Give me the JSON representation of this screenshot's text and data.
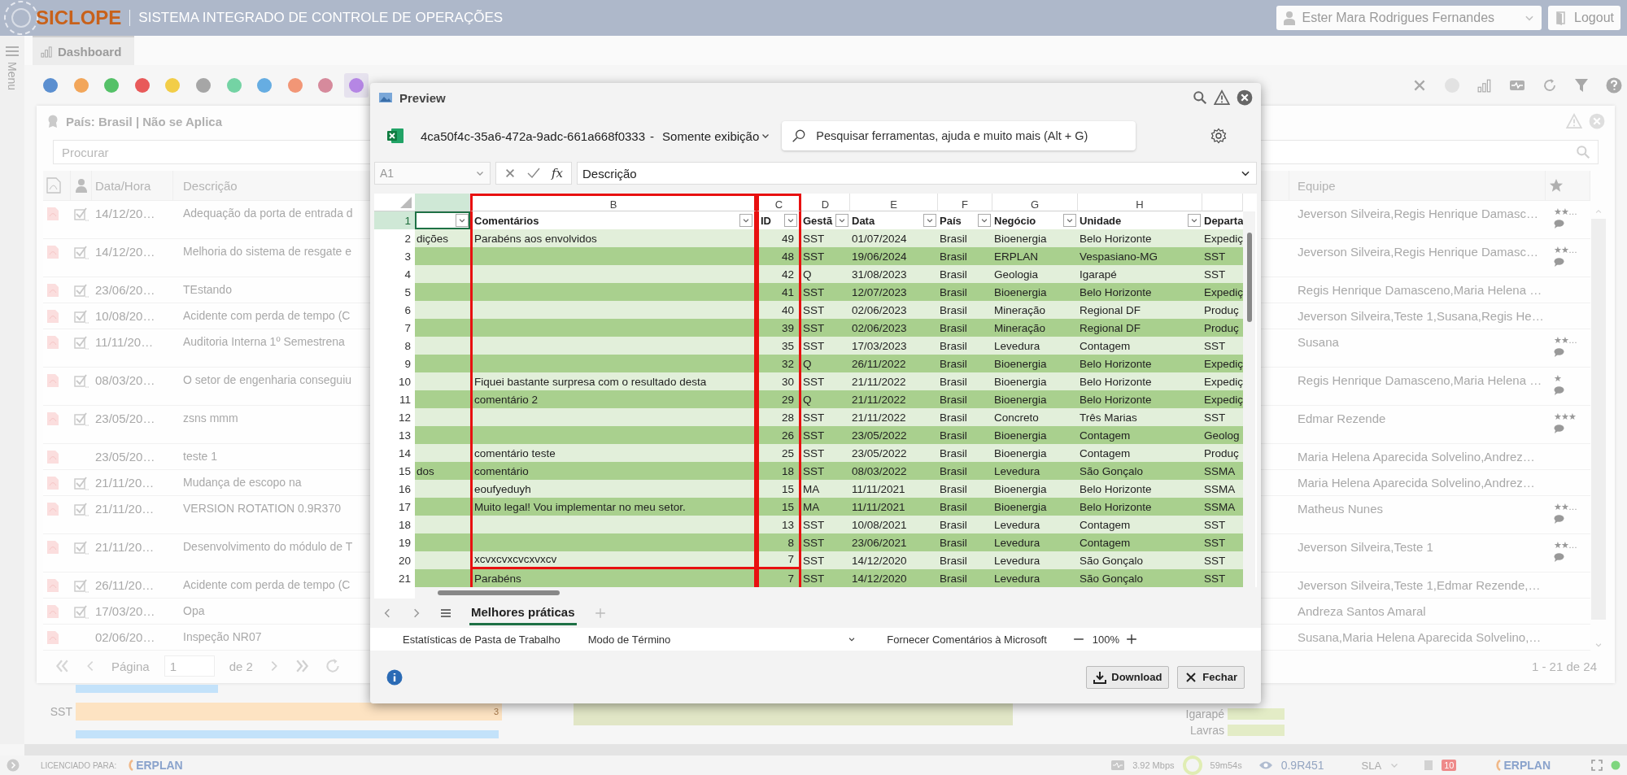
{
  "header": {
    "logo": "SICLOPE",
    "title": "SISTEMA INTEGRADO DE CONTROLE DE OPERAÇÕES",
    "user": "Ester Mara Rodrigues Fernandes",
    "logout": "Logout"
  },
  "sidebar": {
    "label": "Menu"
  },
  "tabs": [
    {
      "label": "Dashboard",
      "selected": true
    }
  ],
  "color_filters": [
    {
      "color": "#5b8fd0",
      "selected": false
    },
    {
      "color": "#f2a65a",
      "selected": false
    },
    {
      "color": "#55c168",
      "selected": false
    },
    {
      "color": "#e85a5a",
      "selected": false
    },
    {
      "color": "#f2cd48",
      "selected": false
    },
    {
      "color": "#a6a6a6",
      "selected": false
    },
    {
      "color": "#74d3a4",
      "selected": false
    },
    {
      "color": "#66ade2",
      "selected": false
    },
    {
      "color": "#f29676",
      "selected": false
    },
    {
      "color": "#d68a9c",
      "selected": false
    },
    {
      "color": "#b586e4",
      "selected": true
    }
  ],
  "panel": {
    "title": "País: Brasil | Não se Aplica",
    "search": {
      "placeholder": "Procurar"
    },
    "columns": {
      "date": "Data/Hora",
      "description": "Descrição",
      "team": "Equipe"
    },
    "rows": [
      {
        "checked": true,
        "date": "14/12/20…",
        "description": "Adequação da porta de entrada d",
        "team": "Jeverson Silveira,Regis Henrique Damasc…",
        "rating": "★★…",
        "comment": true
      },
      {
        "checked": true,
        "date": "14/12/20…",
        "description": "Melhoria do sistema de resgate e",
        "team": "Jeverson Silveira,Regis Henrique Damasc…",
        "rating": "★★…",
        "comment": true
      },
      {
        "checked": true,
        "date": "23/06/20…",
        "description": "TEstando",
        "team": "Regis Henrique Damasceno,Maria Helena …",
        "comment": false
      },
      {
        "checked": true,
        "date": "10/08/20…",
        "description": "Acidente com perda de tempo (C",
        "team": "Jeverson Silveira,Teste 1,Susana,Regis He…",
        "comment": false
      },
      {
        "checked": true,
        "date": "11/11/20…",
        "description": "Auditoria Interna 1º Semestrena",
        "team": "Susana",
        "rating": "★★…",
        "comment": true
      },
      {
        "checked": true,
        "date": "08/03/20…",
        "description": "O setor de engenharia conseguiu",
        "team": "Regis Henrique Damasceno,Maria Helena …",
        "rating": "★",
        "comment": true
      },
      {
        "checked": true,
        "date": "23/05/20…",
        "description": "zsns mmm",
        "team": "Edmar Rezende",
        "rating": "★★★",
        "comment": true
      },
      {
        "checked": false,
        "date": "23/05/20…",
        "description": "teste 1",
        "team": "Maria Helena Aparecida Solvelino,Andrez…",
        "comment": false
      },
      {
        "checked": true,
        "date": "21/11/20…",
        "description": "Mudança de escopo na",
        "team": "Maria Helena Aparecida Solvelino,Andrez…",
        "comment": false
      },
      {
        "checked": true,
        "date": "21/11/20…",
        "description": "VERSION ROTATION 0.9R370",
        "team": "Matheus Nunes",
        "rating": "★★…",
        "comment": true
      },
      {
        "checked": true,
        "date": "21/11/20…",
        "description": "Desenvolvimento do módulo de T",
        "team": "Jeverson Silveira,Teste 1",
        "rating": "★★…",
        "comment": true
      },
      {
        "checked": true,
        "date": "26/11/20…",
        "description": "Acidente com perda de tempo (C",
        "team": "Jeverson Silveira,Teste 1,Edmar Rezende,…",
        "comment": false
      },
      {
        "checked": true,
        "date": "17/03/20…",
        "description": "Opa",
        "team": "Andreza Santos Amaral",
        "comment": false
      },
      {
        "checked": false,
        "date": "02/06/20…",
        "description": "Inspeção NR07",
        "team": "Susana,Maria Helena Aparecida Solvelino,…",
        "comment": false
      }
    ],
    "pager": {
      "page_label": "Página",
      "page": "1",
      "of": "de 2",
      "range": "1 - 21 de 24"
    }
  },
  "background_chart": {
    "category": "SST",
    "bar_value": "3",
    "labels": [
      "Igarapé",
      "Lavras"
    ]
  },
  "preview": {
    "title": "Preview",
    "file_name": "4ca50f4c-35a6-472a-9adc-661a668f0333",
    "separator": "-",
    "mode": "Somente exibição",
    "search": {
      "placeholder": "Pesquisar ferramentas, ajuda e muito mais (Alt + G)"
    },
    "name_box": "A1",
    "function_label": "fx",
    "formula": "Descrição",
    "sheet": {
      "columns": [
        {
          "selected": true,
          "highlighted": false,
          "filter": true
        },
        {
          "letter": "B",
          "header": "Comentários",
          "selected": false,
          "highlighted": true,
          "filter": true
        },
        {
          "letter": "C",
          "header": "ID",
          "selected": false,
          "highlighted": true,
          "filter": true
        },
        {
          "letter": "D",
          "header": "Gestã",
          "selected": false,
          "highlighted": false,
          "filter": true
        },
        {
          "letter": "E",
          "header": "Data",
          "selected": false,
          "highlighted": false,
          "filter": true
        },
        {
          "letter": "F",
          "header": "País",
          "selected": false,
          "highlighted": false,
          "filter": true
        },
        {
          "letter": "G",
          "header": "Negócio",
          "selected": false,
          "highlighted": false,
          "filter": true
        },
        {
          "letter": "H",
          "header": "Unidade",
          "selected": false,
          "highlighted": false,
          "filter": true
        },
        {
          "header": "Departa",
          "selected": false,
          "highlighted": false,
          "filter": false
        }
      ],
      "header_row": {
        "number": "1",
        "selected": true
      },
      "rows": [
        {
          "number": "2",
          "a": "dições",
          "comments": "Parabéns aos envolvidos",
          "id": "49",
          "management": "SST",
          "date": "01/07/2024",
          "country": "Brasil",
          "business": "Bioenergia",
          "unit": "Belo Horizonte",
          "department": "Expediç"
        },
        {
          "number": "3",
          "id": "48",
          "management": "SST",
          "date": "19/06/2024",
          "country": "Brasil",
          "business": "ERPLAN",
          "unit": "Vespasiano-MG",
          "department": "SST"
        },
        {
          "number": "4",
          "id": "42",
          "management": "Q",
          "date": "31/08/2023",
          "country": "Brasil",
          "business": "Geologia",
          "unit": "Igarapé",
          "department": "SST"
        },
        {
          "number": "5",
          "id": "41",
          "management": "SST",
          "date": "12/07/2023",
          "country": "Brasil",
          "business": "Bioenergia",
          "unit": "Belo Horizonte",
          "department": "Expediç"
        },
        {
          "number": "6",
          "id": "40",
          "management": "SST",
          "date": "02/06/2023",
          "country": "Brasil",
          "business": "Mineração",
          "unit": "Regional DF",
          "department": "Produç"
        },
        {
          "number": "7",
          "id": "39",
          "management": "SST",
          "date": "02/06/2023",
          "country": "Brasil",
          "business": "Mineração",
          "unit": "Regional DF",
          "department": "Produç"
        },
        {
          "number": "8",
          "id": "35",
          "management": "SST",
          "date": "17/03/2023",
          "country": "Brasil",
          "business": "Levedura",
          "unit": "Contagem",
          "department": "SST"
        },
        {
          "number": "9",
          "id": "32",
          "management": "Q",
          "date": "26/11/2022",
          "country": "Brasil",
          "business": "Bioenergia",
          "unit": "Belo Horizonte",
          "department": "Expediç"
        },
        {
          "number": "10",
          "comments": "Fiquei bastante surpresa com o resultado desta",
          "id": "30",
          "management": "SST",
          "date": "21/11/2022",
          "country": "Brasil",
          "business": "Bioenergia",
          "unit": "Belo Horizonte",
          "department": "Expediç"
        },
        {
          "number": "11",
          "comments": "comentário 2",
          "id": "29",
          "management": "Q",
          "date": "21/11/2022",
          "country": "Brasil",
          "business": "Bioenergia",
          "unit": "Belo Horizonte",
          "department": "Expediç"
        },
        {
          "number": "12",
          "id": "28",
          "management": "SST",
          "date": "21/11/2022",
          "country": "Brasil",
          "business": "Concreto",
          "unit": "Três Marias",
          "department": "SST"
        },
        {
          "number": "13",
          "id": "26",
          "management": "SST",
          "date": "23/05/2022",
          "country": "Brasil",
          "business": "Bioenergia",
          "unit": "Contagem",
          "department": "Geolog"
        },
        {
          "number": "14",
          "comments": "comentário teste",
          "id": "25",
          "management": "SST",
          "date": "23/05/2022",
          "country": "Brasil",
          "business": "Bioenergia",
          "unit": "Contagem",
          "department": "Produç"
        },
        {
          "number": "15",
          "a": "dos",
          "comments": "comentário",
          "id": "18",
          "management": "SST",
          "date": "08/03/2022",
          "country": "Brasil",
          "business": "Levedura",
          "unit": "São Gonçalo",
          "department": "SSMA"
        },
        {
          "number": "16",
          "comments": "eoufyeduyh",
          "id": "15",
          "management": "MA",
          "date": "11/11/2021",
          "country": "Brasil",
          "business": "Bioenergia",
          "unit": "Belo Horizonte",
          "department": "SSMA"
        },
        {
          "number": "17",
          "comments": "Muito legal! Vou implementar no meu setor.",
          "id": "15",
          "management": "MA",
          "date": "11/11/2021",
          "country": "Brasil",
          "business": "Bioenergia",
          "unit": "Belo Horizonte",
          "department": "SSMA"
        },
        {
          "number": "18",
          "id": "13",
          "management": "SST",
          "date": "10/08/2021",
          "country": "Brasil",
          "business": "Levedura",
          "unit": "Contagem",
          "department": "SST"
        },
        {
          "number": "19",
          "id": "8",
          "management": "SST",
          "date": "23/06/2021",
          "country": "Brasil",
          "business": "Levedura",
          "unit": "Contagem",
          "department": "SST"
        },
        {
          "number": "20",
          "comments": "xcvxcvxcvcxvxcv",
          "id": "7",
          "management": "SST",
          "date": "14/12/2020",
          "country": "Brasil",
          "business": "Levedura",
          "unit": "São Gonçalo",
          "department": "SST"
        },
        {
          "number": "21",
          "comments": "Parabéns",
          "id": "7",
          "management": "SST",
          "date": "14/12/2020",
          "country": "Brasil",
          "business": "Levedura",
          "unit": "São Gonçalo",
          "department": "SST"
        }
      ]
    },
    "sheet_tabs": [
      {
        "label": "Melhores práticas",
        "selected": true
      }
    ],
    "status": {
      "stats": "Estatísticas de Pasta de Trabalho",
      "mode": "Modo de Término",
      "feedback": "Fornecer Comentários à Microsoft",
      "zoom": "100%"
    },
    "buttons": [
      {
        "label": "Download",
        "kind": "download"
      },
      {
        "label": "Fechar",
        "kind": "close"
      }
    ]
  },
  "status_bar": {
    "license_label": "LICENCIADO PARA:",
    "brand": "ERPLAN",
    "speed": "3.92 Mbps",
    "timer": "59m54s",
    "version": "0.9R451",
    "sla": "SLA",
    "badge": "10",
    "brand_right": "ERPLAN"
  }
}
